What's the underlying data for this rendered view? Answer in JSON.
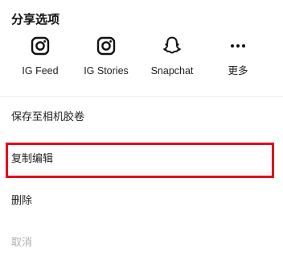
{
  "share": {
    "title": "分享选项",
    "items": [
      {
        "label": "IG Feed",
        "icon": "instagram-icon"
      },
      {
        "label": "IG Stories",
        "icon": "instagram-icon"
      },
      {
        "label": "Snapchat",
        "icon": "snapchat-ghost-icon"
      },
      {
        "label": "更多",
        "icon": "more-dots-icon"
      }
    ]
  },
  "menu": {
    "save_label": "保存至相机胶卷",
    "copy_label": "复制编辑",
    "delete_label": "删除",
    "cancel_label": "取消"
  },
  "colors": {
    "highlight": "#e0101b",
    "text": "#222222",
    "disabled_text": "#b0b0b0",
    "divider": "#ececec"
  }
}
